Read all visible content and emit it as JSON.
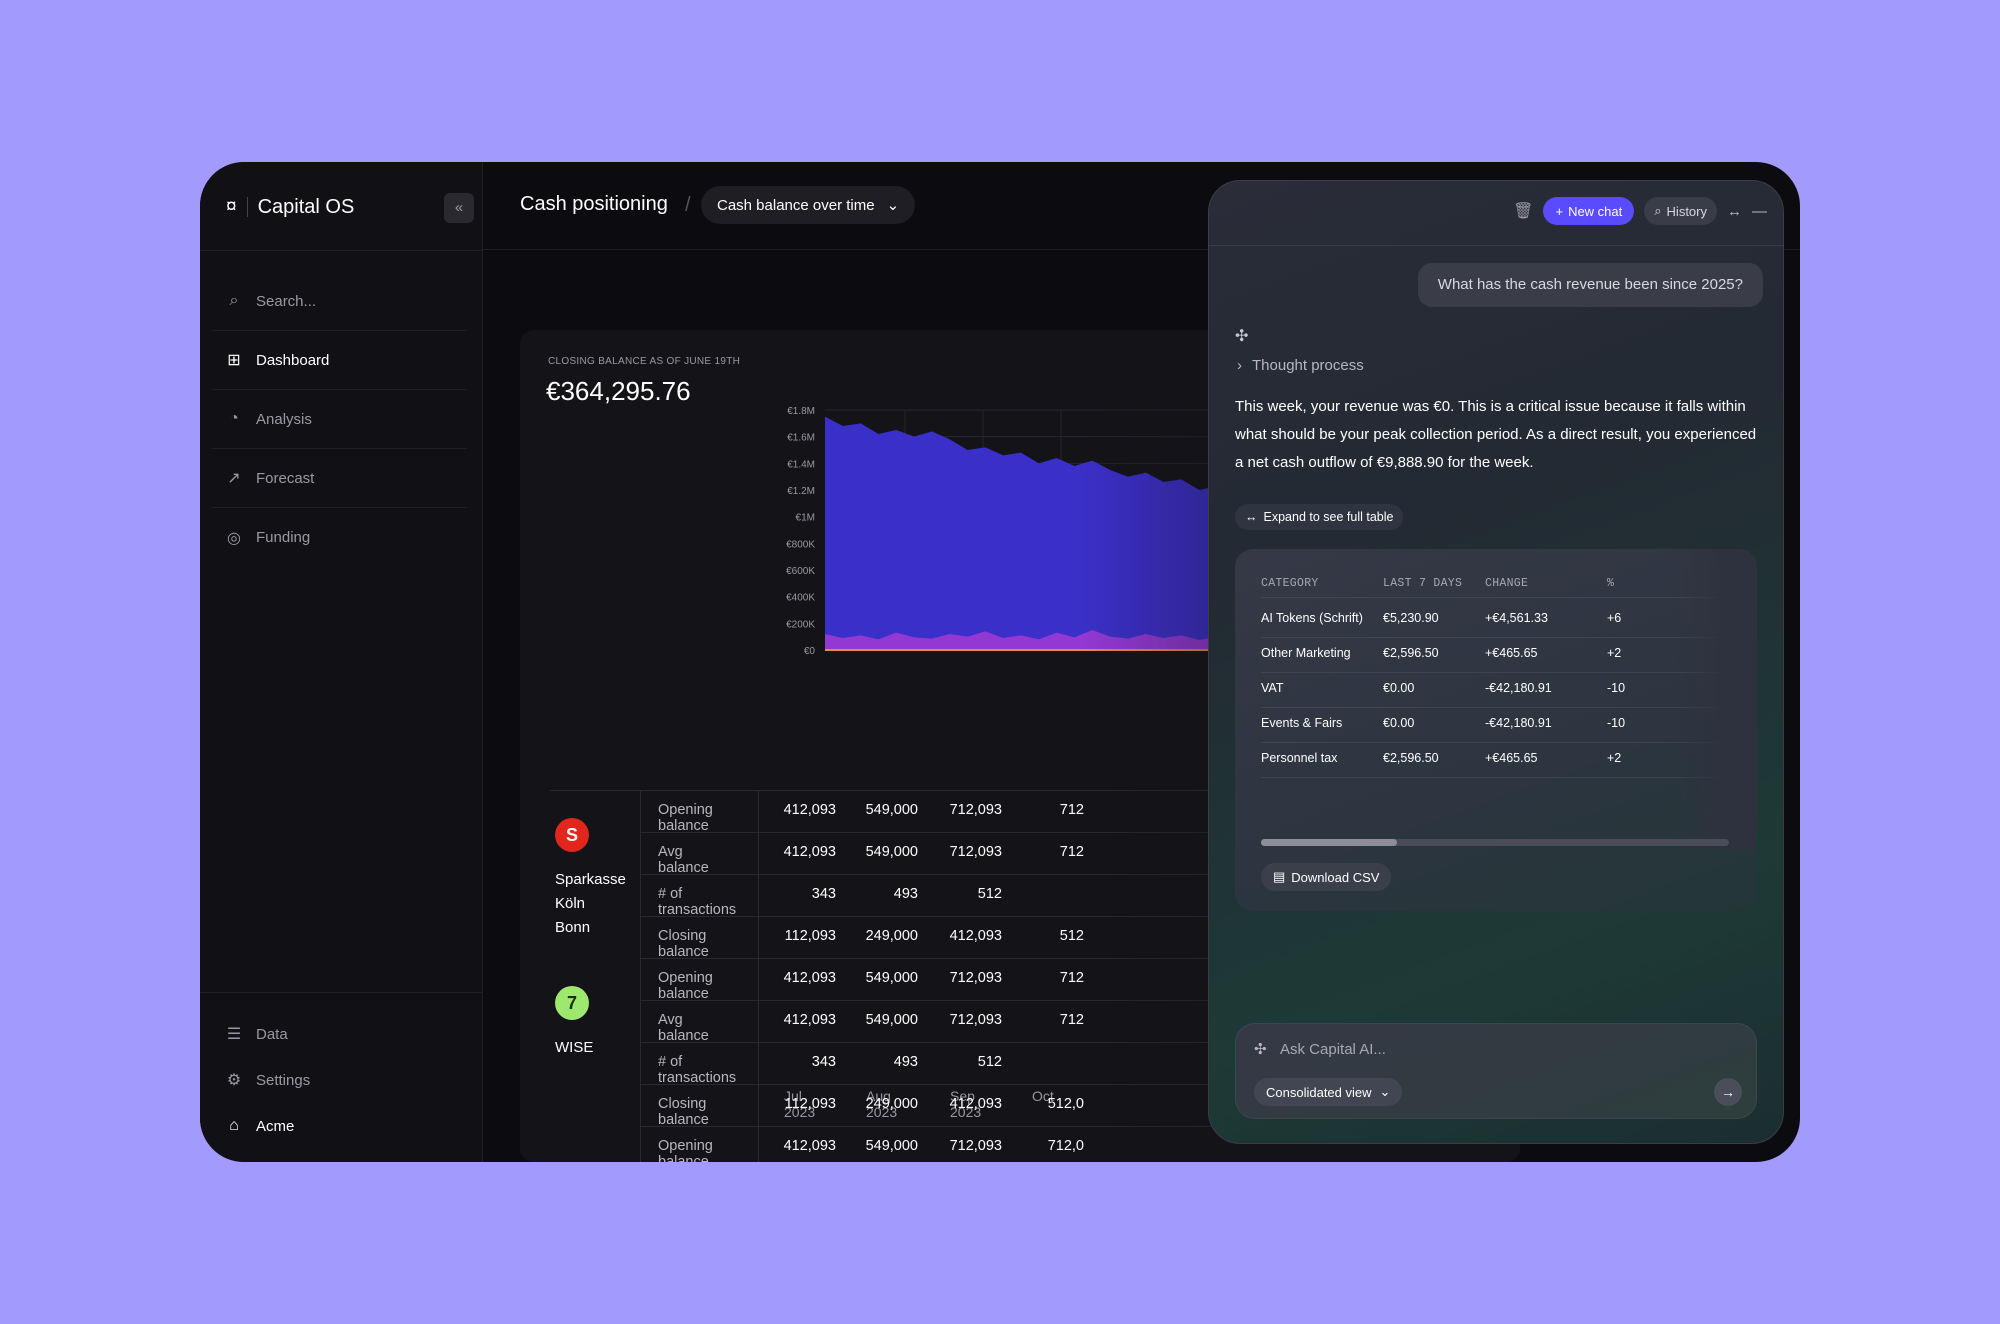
{
  "app": {
    "name": "Capital OS",
    "logo": "¤"
  },
  "sidebar": {
    "search_placeholder": "Search...",
    "items": [
      {
        "label": "Dashboard",
        "icon": "⊞"
      },
      {
        "label": "Analysis",
        "icon": "◔"
      },
      {
        "label": "Forecast",
        "icon": "↗"
      },
      {
        "label": "Funding",
        "icon": "◎"
      }
    ],
    "bottom_items": [
      {
        "label": "Data",
        "icon": "☰"
      },
      {
        "label": "Settings",
        "icon": "⚙"
      },
      {
        "label": "Acme",
        "icon": "⌂"
      }
    ]
  },
  "header": {
    "title": "Cash positioning",
    "separator": "/",
    "view": "Cash balance over time"
  },
  "chart_card": {
    "closing_label": "CLOSING BALANCE AS OF JUNE 19TH",
    "closing_value": "€364,295.76"
  },
  "chart_data": {
    "type": "area",
    "title": "",
    "xlabel": "",
    "ylabel": "",
    "ylim": [
      0,
      1800000
    ],
    "y_ticks": [
      "€0",
      "€200K",
      "€400K",
      "€600K",
      "€800K",
      "€1M",
      "€1.2M",
      "€1.4M",
      "€1.6M",
      "€1.8M"
    ],
    "series": [
      {
        "values": [
          1750000,
          1680000,
          1700000,
          1620000,
          1650000,
          1600000,
          1640000,
          1580000,
          1500000,
          1520000,
          1460000,
          1480000,
          1400000,
          1440000,
          1380000,
          1420000,
          1350000,
          1300000,
          1330000,
          1260000,
          1280000,
          1200000,
          1230000,
          1180000,
          1100000,
          1150000,
          1080000,
          1120000,
          1050000,
          1090000,
          1000000,
          1040000,
          980000,
          1020000,
          960000,
          990000,
          940000,
          980000,
          920000,
          950000
        ]
      },
      {
        "values": [
          120000,
          90000,
          110000,
          80000,
          130000,
          95000,
          85000,
          120000,
          100000,
          140000,
          90000,
          110000,
          80000,
          130000,
          95000,
          150000,
          100000,
          85000,
          120000,
          90000,
          110000,
          75000,
          100000,
          120000,
          80000,
          95000,
          110000,
          85000,
          70000,
          100000,
          90000,
          80000,
          110000,
          75000,
          95000,
          85000,
          100000,
          80000,
          90000,
          70000
        ]
      }
    ],
    "colors": [
      "#3b2fc9",
      "#a43ad6",
      "#e0922c"
    ]
  },
  "table": {
    "months": [
      "Jul 2023",
      "Aug 2023",
      "Sep 2023",
      "Oct"
    ],
    "banks": [
      {
        "name_line1": "Sparkasse",
        "name_line2": "Köln Bonn",
        "logo": "S",
        "logo_color": "#e2261c",
        "rows": [
          {
            "label": "Opening balance",
            "values": [
              "412,093",
              "549,000",
              "712,093",
              "712"
            ]
          },
          {
            "label": "Avg balance",
            "values": [
              "412,093",
              "549,000",
              "712,093",
              "712"
            ]
          },
          {
            "label": "# of transactions",
            "values": [
              "343",
              "493",
              "512",
              ""
            ]
          },
          {
            "label": "Closing balance",
            "values": [
              "112,093",
              "249,000",
              "412,093",
              "512"
            ]
          }
        ]
      },
      {
        "name_line1": "WISE",
        "name_line2": "",
        "logo": "7",
        "logo_color": "#9fe870",
        "rows": [
          {
            "label": "Opening balance",
            "values": [
              "412,093",
              "549,000",
              "712,093",
              "712"
            ]
          },
          {
            "label": "Avg balance",
            "values": [
              "412,093",
              "549,000",
              "712,093",
              "712"
            ]
          },
          {
            "label": "# of transactions",
            "values": [
              "343",
              "493",
              "512",
              ""
            ]
          },
          {
            "label": "Closing balance",
            "values": [
              "112,093",
              "249,000",
              "412,093",
              "512,0"
            ]
          }
        ]
      },
      {
        "name_line1": "",
        "name_line2": "",
        "logo": "/",
        "logo_color": "#1c3fa8",
        "rows": [
          {
            "label": "Opening balance",
            "values": [
              "412,093",
              "549,000",
              "712,093",
              "712,0"
            ]
          }
        ]
      }
    ]
  },
  "ai_panel": {
    "new_chat": "New chat",
    "history": "History",
    "user_message": "What has the cash revenue been since 2025?",
    "thought_process": "Thought process",
    "answer": "This week, your revenue was €0. This is a critical issue because it falls within what should be your peak collection period. As a direct result, you experienced a net cash outflow of €9,888.90 for the week.",
    "expand_label": "Expand to see full table",
    "result_table": {
      "headers": [
        "CATEGORY",
        "LAST 7 DAYS",
        "CHANGE",
        "%"
      ],
      "rows": [
        {
          "category": "AI Tokens (Schrift)",
          "last7": "€5,230.90",
          "change": "+€4,561.33",
          "pct": "+6"
        },
        {
          "category": "Other Marketing",
          "last7": "€2,596.50",
          "change": "+€465.65",
          "pct": "+2"
        },
        {
          "category": "VAT",
          "last7": "€0.00",
          "change": "-€42,180.91",
          "pct": "-10"
        },
        {
          "category": "Events & Fairs",
          "last7": "€0.00",
          "change": "-€42,180.91",
          "pct": "-10"
        },
        {
          "category": "Personnel tax",
          "last7": "€2,596.50",
          "change": "+€465.65",
          "pct": "+2"
        }
      ],
      "scroll_position": 0.29
    },
    "download_csv": "Download CSV",
    "ask_placeholder": "Ask Capital AI...",
    "consolidated": "Consolidated view"
  }
}
